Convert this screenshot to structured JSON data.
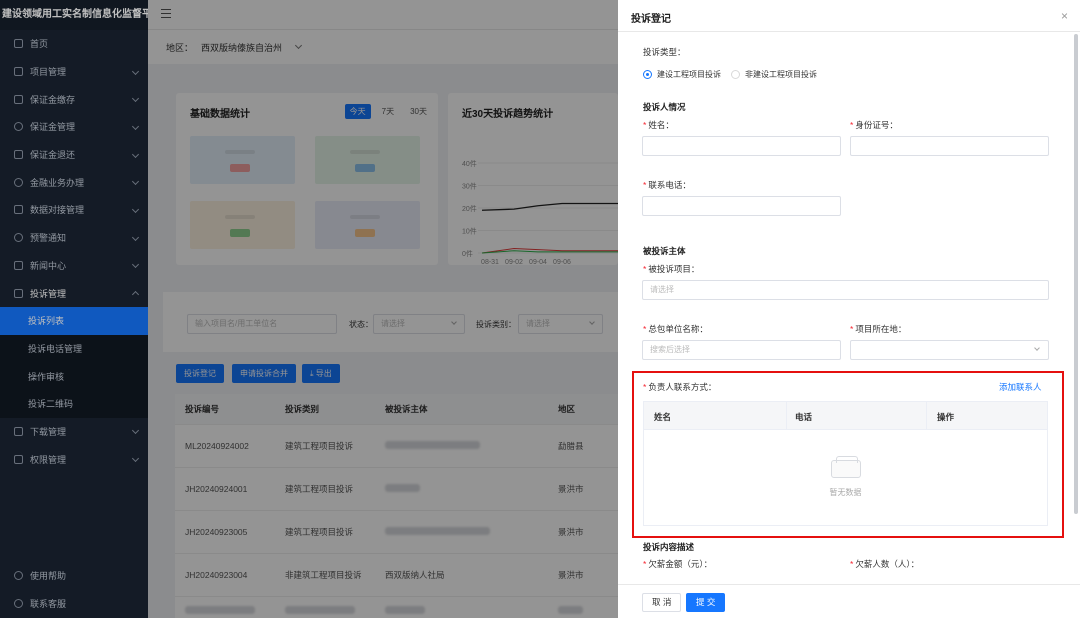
{
  "app": {
    "title": "建设领域用工实名制信息化监督平台"
  },
  "sidebar": {
    "items": [
      {
        "label": "首页"
      },
      {
        "label": "项目管理"
      },
      {
        "label": "保证金缴存"
      },
      {
        "label": "保证金管理"
      },
      {
        "label": "保证金退还"
      },
      {
        "label": "金融业务办理"
      },
      {
        "label": "数据对接管理"
      },
      {
        "label": "预警通知"
      },
      {
        "label": "新闻中心"
      },
      {
        "label": "投诉管理"
      }
    ],
    "subitems": [
      {
        "label": "投诉列表"
      },
      {
        "label": "投诉电话管理"
      },
      {
        "label": "操作审核"
      },
      {
        "label": "投诉二维码"
      }
    ],
    "items2": [
      {
        "label": "下载管理"
      },
      {
        "label": "权限管理"
      }
    ],
    "help": "使用帮助",
    "support": "联系客服"
  },
  "region": {
    "label": "地区：",
    "value": "西双版纳傣族自治州"
  },
  "stats": {
    "title": "基础数据统计",
    "tabs": [
      "今天",
      "7天",
      "30天"
    ]
  },
  "trend": {
    "title": "近30天投诉趋势统计"
  },
  "chart_data": {
    "type": "line",
    "title": "近30天投诉趋势统计",
    "x": [
      "08-31",
      "09-02",
      "09-04",
      "09-06"
    ],
    "yticks": [
      "0件",
      "10件",
      "20件",
      "30件",
      "40件"
    ],
    "ylim": [
      0,
      40
    ],
    "series": [
      {
        "values": [
          19,
          19.5,
          21,
          22
        ]
      },
      {
        "values": [
          0,
          2,
          1.5,
          1
        ]
      },
      {
        "values": [
          0,
          1,
          0.5,
          0.5
        ]
      }
    ]
  },
  "filter": {
    "search_placeholder": "输入项目名/用工单位名",
    "status_label": "状态：",
    "status_placeholder": "请选择",
    "type_label": "投诉类别：",
    "type_placeholder": "请选择"
  },
  "actions": {
    "register": "投诉登记",
    "merge": "申请投诉合并",
    "export": "导出"
  },
  "table": {
    "columns": [
      "投诉编号",
      "投诉类别",
      "被投诉主体",
      "地区"
    ],
    "rows": [
      {
        "id": "ML20240924002",
        "type": "建筑工程项目投诉",
        "subject": "",
        "region": "勐腊县"
      },
      {
        "id": "JH20240924001",
        "type": "建筑工程项目投诉",
        "subject": "",
        "region": "景洪市"
      },
      {
        "id": "JH20240923005",
        "type": "建筑工程项目投诉",
        "subject": "",
        "region": "景洪市"
      },
      {
        "id": "JH20240923004",
        "type": "非建筑工程项目投诉",
        "subject": "西双版纳人社局",
        "region": "景洪市"
      }
    ]
  },
  "drawer": {
    "title": "投诉登记",
    "close": "×",
    "type_label": "投诉类型：",
    "radio_a": "建设工程项目投诉",
    "radio_b": "非建设工程项目投诉",
    "section_person": "投诉人情况",
    "name_label": "姓名：",
    "id_label": "身份证号：",
    "phone_label": "联系电话：",
    "section_subject": "被投诉主体",
    "project_label": "被投诉项目：",
    "project_placeholder": "请选择",
    "contractor_label": "总包单位名称：",
    "contractor_placeholder": "搜索后选择",
    "location_label": "项目所在地：",
    "contact_label": "负责人联系方式：",
    "add_contact": "添加联系人",
    "contact_columns": [
      "姓名",
      "电话",
      "操作"
    ],
    "empty_text": "暂无数据",
    "section_content": "投诉内容描述",
    "amount_label": "欠薪金额（元）：",
    "count_label": "欠薪人数（人）：",
    "cancel": "取 消",
    "submit": "提 交"
  },
  "colors": {
    "primary": "#1677ff",
    "highlight": "#e5100f",
    "sidebar": "#1b2533"
  }
}
